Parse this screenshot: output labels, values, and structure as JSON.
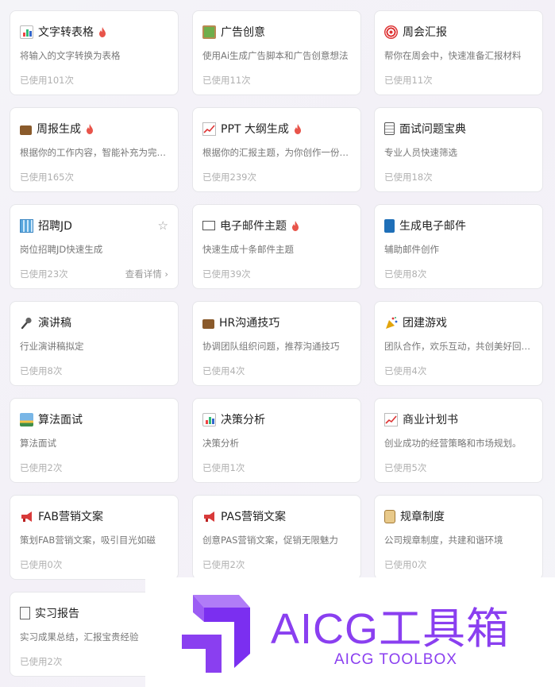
{
  "cards": [
    {
      "title": "文字转表格",
      "icon": "bar-chart-icon",
      "hot": true,
      "desc": "将输入的文字转换为表格",
      "used": "已使用101次"
    },
    {
      "title": "广告创意",
      "icon": "framed-picture-icon",
      "hot": false,
      "desc": "使用Ai生成广告脚本和广告创意想法",
      "used": "已使用11次"
    },
    {
      "title": "周会汇报",
      "icon": "target-icon",
      "hot": false,
      "desc": "帮你在周会中，快速准备汇报材料",
      "used": "已使用11次"
    },
    {
      "title": "周报生成",
      "icon": "briefcase-icon",
      "hot": true,
      "desc": "根据你的工作内容，智能补充为完…",
      "used": "已使用165次"
    },
    {
      "title": "PPT 大纲生成",
      "icon": "chart-increasing-icon",
      "hot": true,
      "desc": "根据你的汇报主题，为你创作一份…",
      "used": "已使用239次"
    },
    {
      "title": "面试问题宝典",
      "icon": "clipboard-icon",
      "hot": false,
      "desc": "专业人员快速筛选",
      "used": "已使用18次"
    },
    {
      "title": "招聘JD",
      "icon": "office-building-icon",
      "hot": false,
      "desc": "岗位招聘JD快速生成",
      "used": "已使用23次",
      "star": true,
      "detail": "查看详情"
    },
    {
      "title": "电子邮件主题",
      "icon": "envelope-icon",
      "hot": true,
      "desc": "快速生成十条邮件主题",
      "used": "已使用39次"
    },
    {
      "title": "生成电子邮件",
      "icon": "blue-book-icon",
      "hot": false,
      "desc": "辅助邮件创作",
      "used": "已使用8次"
    },
    {
      "title": "演讲稿",
      "icon": "microphone-icon",
      "hot": false,
      "desc": "行业演讲稿拟定",
      "used": "已使用8次"
    },
    {
      "title": "HR沟通技巧",
      "icon": "briefcase-icon",
      "hot": false,
      "desc": "协调团队组织问题，推荐沟通技巧",
      "used": "已使用4次"
    },
    {
      "title": "团建游戏",
      "icon": "party-popper-icon",
      "hot": false,
      "desc": "团队合作，欢乐互动，共创美好回…",
      "used": "已使用4次"
    },
    {
      "title": "算法面试",
      "icon": "sunrise-icon",
      "hot": false,
      "desc": "算法面试",
      "used": "已使用2次"
    },
    {
      "title": "决策分析",
      "icon": "bar-chart-icon",
      "hot": false,
      "desc": "决策分析",
      "used": "已使用1次"
    },
    {
      "title": "商业计划书",
      "icon": "chart-increasing-icon",
      "hot": false,
      "desc": "创业成功的经营策略和市场规划。",
      "used": "已使用5次"
    },
    {
      "title": "FAB营销文案",
      "icon": "megaphone-icon",
      "hot": false,
      "desc": "策划FAB营销文案，吸引目光如磁",
      "used": "已使用0次"
    },
    {
      "title": "PAS营销文案",
      "icon": "megaphone-icon",
      "hot": false,
      "desc": "创意PAS营销文案，促销无限魅力",
      "used": "已使用2次"
    },
    {
      "title": "规章制度",
      "icon": "scroll-icon",
      "hot": false,
      "desc": "公司规章制度，共建和谐环境",
      "used": "已使用0次"
    },
    {
      "title": "实习报告",
      "icon": "page-icon",
      "hot": false,
      "desc": "实习成果总结，汇报宝贵经验",
      "used": "已使用2次"
    }
  ],
  "watermark": {
    "title": "AICG工具箱",
    "subtitle": "AICG TOOLBOX"
  },
  "colors": {
    "brand": "#8a3ff0",
    "hot": "#e8544a",
    "card_bg": "#ffffff"
  }
}
